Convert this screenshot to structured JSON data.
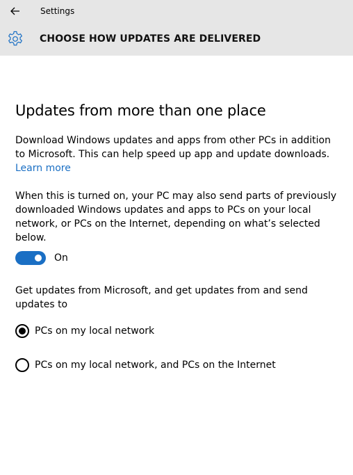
{
  "titlebar": {
    "back_icon": "back-arrow-icon",
    "app_title": "Settings"
  },
  "header": {
    "icon": "gear-icon",
    "title": "CHOOSE HOW UPDATES ARE DELIVERED"
  },
  "main": {
    "section_title": "Updates from more than one place",
    "description": "Download Windows updates and apps from other PCs in addition to Microsoft. This can help speed up app and update downloads.",
    "learn_more": "Learn more",
    "toggle_description": "When this is turned on, your PC may also send parts of previously downloaded Windows updates and apps to PCs on your local network, or PCs on the Internet, depending on what’s selected below.",
    "toggle": {
      "state": "On",
      "accent": "#1a6fc4"
    },
    "radio_prompt": "Get updates from Microsoft, and get updates from and send updates to",
    "radio_options": [
      {
        "label": "PCs on my local network",
        "selected": true
      },
      {
        "label": "PCs on my local network, and PCs on the Internet",
        "selected": false
      }
    ]
  }
}
